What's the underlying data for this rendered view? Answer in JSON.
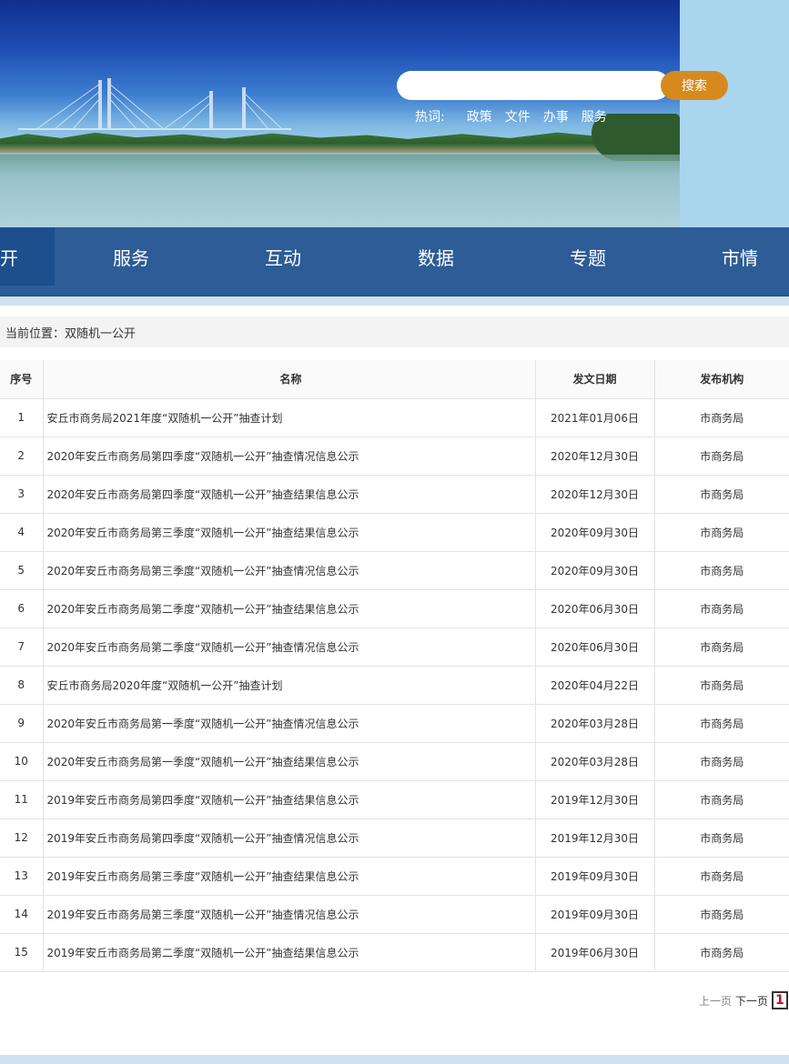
{
  "search": {
    "placeholder": "",
    "button_label": "搜索"
  },
  "hotwords": {
    "label": "热词:",
    "items": [
      "政策",
      "文件",
      "办事",
      "服务"
    ]
  },
  "nav": {
    "items": [
      "开",
      "服务",
      "互动",
      "数据",
      "专题",
      "市情"
    ],
    "active_index": 0
  },
  "breadcrumb": {
    "text": "当前位置：双随机一公开"
  },
  "table": {
    "headers": {
      "no": "序号",
      "name": "名称",
      "date": "发文日期",
      "org": "发布机构"
    },
    "rows": [
      {
        "no": "1",
        "name": "安丘市商务局2021年度“双随机一公开”抽查计划",
        "date": "2021年01月06日",
        "org": "市商务局"
      },
      {
        "no": "2",
        "name": "2020年安丘市商务局第四季度“双随机一公开”抽查情况信息公示",
        "date": "2020年12月30日",
        "org": "市商务局"
      },
      {
        "no": "3",
        "name": "2020年安丘市商务局第四季度“双随机一公开”抽查结果信息公示",
        "date": "2020年12月30日",
        "org": "市商务局"
      },
      {
        "no": "4",
        "name": "2020年安丘市商务局第三季度“双随机一公开”抽查结果信息公示",
        "date": "2020年09月30日",
        "org": "市商务局"
      },
      {
        "no": "5",
        "name": "2020年安丘市商务局第三季度“双随机一公开”抽查情况信息公示",
        "date": "2020年09月30日",
        "org": "市商务局"
      },
      {
        "no": "6",
        "name": "2020年安丘市商务局第二季度“双随机一公开”抽查结果信息公示",
        "date": "2020年06月30日",
        "org": "市商务局"
      },
      {
        "no": "7",
        "name": "2020年安丘市商务局第二季度“双随机一公开”抽查情况信息公示",
        "date": "2020年06月30日",
        "org": "市商务局"
      },
      {
        "no": "8",
        "name": "安丘市商务局2020年度“双随机一公开”抽查计划",
        "date": "2020年04月22日",
        "org": "市商务局"
      },
      {
        "no": "9",
        "name": "2020年安丘市商务局第一季度“双随机一公开”抽查情况信息公示",
        "date": "2020年03月28日",
        "org": "市商务局"
      },
      {
        "no": "10",
        "name": "2020年安丘市商务局第一季度“双随机一公开”抽查结果信息公示",
        "date": "2020年03月28日",
        "org": "市商务局"
      },
      {
        "no": "11",
        "name": "2019年安丘市商务局第四季度“双随机一公开”抽查结果信息公示",
        "date": "2019年12月30日",
        "org": "市商务局"
      },
      {
        "no": "12",
        "name": "2019年安丘市商务局第四季度“双随机一公开”抽查情况信息公示",
        "date": "2019年12月30日",
        "org": "市商务局"
      },
      {
        "no": "13",
        "name": "2019年安丘市商务局第三季度“双随机一公开”抽查结果信息公示",
        "date": "2019年09月30日",
        "org": "市商务局"
      },
      {
        "no": "14",
        "name": "2019年安丘市商务局第三季度“双随机一公开”抽查情况信息公示",
        "date": "2019年09月30日",
        "org": "市商务局"
      },
      {
        "no": "15",
        "name": "2019年安丘市商务局第二季度“双随机一公开”抽查结果信息公示",
        "date": "2019年06月30日",
        "org": "市商务局"
      }
    ]
  },
  "pager": {
    "prev": "上一页",
    "next": "下一页",
    "current": "1"
  },
  "colors": {
    "nav_bg": "#2d5c97",
    "nav_active": "#1d4f8f",
    "search_button": "#d68a1e",
    "pager_current": "#c0151b"
  }
}
